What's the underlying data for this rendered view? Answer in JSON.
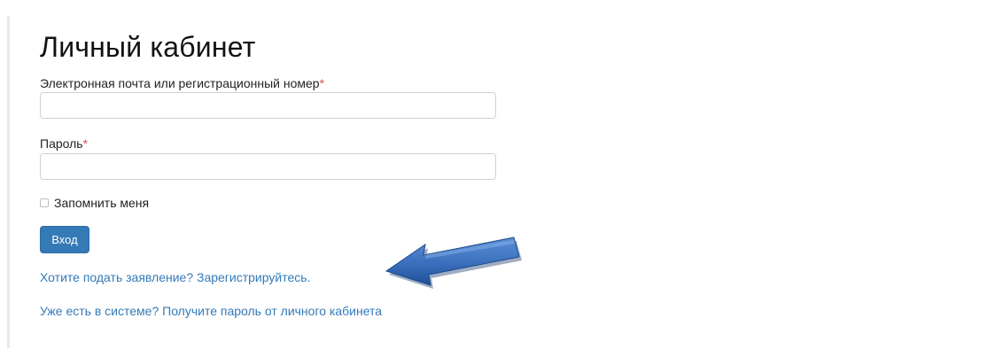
{
  "page": {
    "title": "Личный кабинет"
  },
  "form": {
    "email_label": "Электронная почта или регистрационный номер",
    "email_value": "",
    "password_label": "Пароль",
    "password_value": "",
    "required_mark": "*",
    "remember_label": "Запомнить меня",
    "remember_checked": false,
    "submit_label": "Вход"
  },
  "links": {
    "register": "Хотите подать заявление? Зарегистрируйтесь.",
    "get_password": "Уже есть в системе? Получите пароль от личного кабинета"
  },
  "annotation": {
    "arrow_icon": "blue-arrow-icon",
    "arrow_color": "#3a6fbd"
  },
  "colors": {
    "accent": "#337ab7",
    "required": "#d9534f"
  }
}
